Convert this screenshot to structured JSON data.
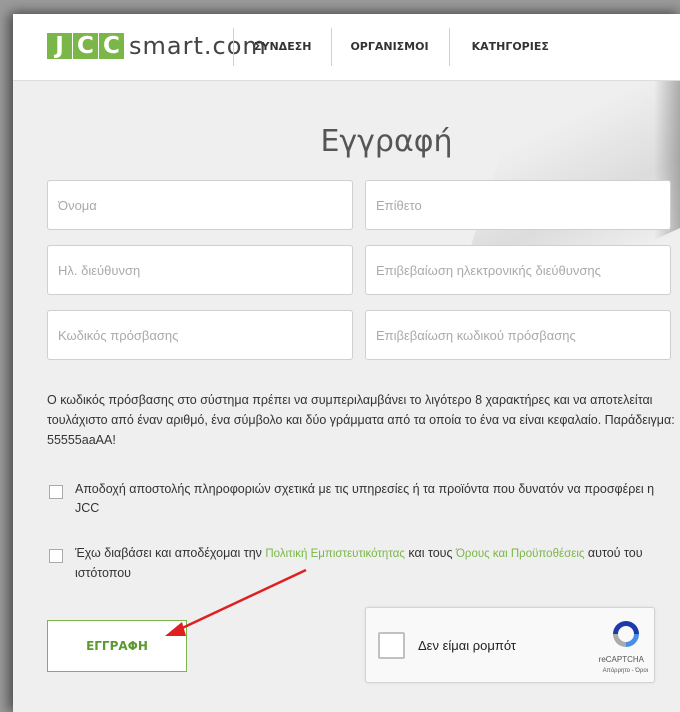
{
  "header": {
    "logo_letters": [
      "J",
      "C",
      "C"
    ],
    "logo_text": "smart.com",
    "nav": [
      "ΣΥΝΔΕΣΗ",
      "ΟΡΓΑΝΙΣΜΟΙ",
      "ΚΑΤΗΓΟΡΙΕΣ"
    ]
  },
  "form": {
    "title": "Εγγραφή",
    "fields": {
      "first_name": "Όνομα",
      "last_name": "Επίθετο",
      "email": "Ηλ. διεύθυνση",
      "email_confirm": "Επιβεβαίωση ηλεκτρονικής διεύθυνσης",
      "password": "Κωδικός πρόσβασης",
      "password_confirm": "Επιβεβαίωση κωδικού πρόσβασης"
    },
    "password_note": "Ο κωδικός πρόσβασης στο σύστημα πρέπει να συμπεριλαμβάνει το λιγότερο 8 χαρακτήρες και να αποτελείται τουλάχιστο από έναν αριθμό, ένα σύμβολο και δύο γράμματα από τα οποία το ένα να είναι κεφαλαίο. Παράδειγμα: 55555aaAA!",
    "consent_info": "Αποδοχή αποστολής πληροφοριών σχετικά με τις υπηρεσίες ή τα προϊόντα που δυνατόν να προσφέρει η JCC",
    "terms": {
      "prefix": "Έχω διαβάσει και αποδέχομαι την ",
      "privacy_link": "Πολιτική Εμπιστευτικότητας",
      "middle": " και τους ",
      "terms_link": "Όρους και Προϋποθέσεις",
      "suffix": " αυτού του ιστότοπου"
    },
    "submit_label": "ΕΓΓΡΑΦΗ"
  },
  "recaptcha": {
    "label": "Δεν είμαι ρομπότ",
    "brand": "reCAPTCHA",
    "terms": "Απόρρητο - Όροι"
  },
  "colors": {
    "brand_green": "#7ab648",
    "annotation_arrow": "#e02020"
  }
}
